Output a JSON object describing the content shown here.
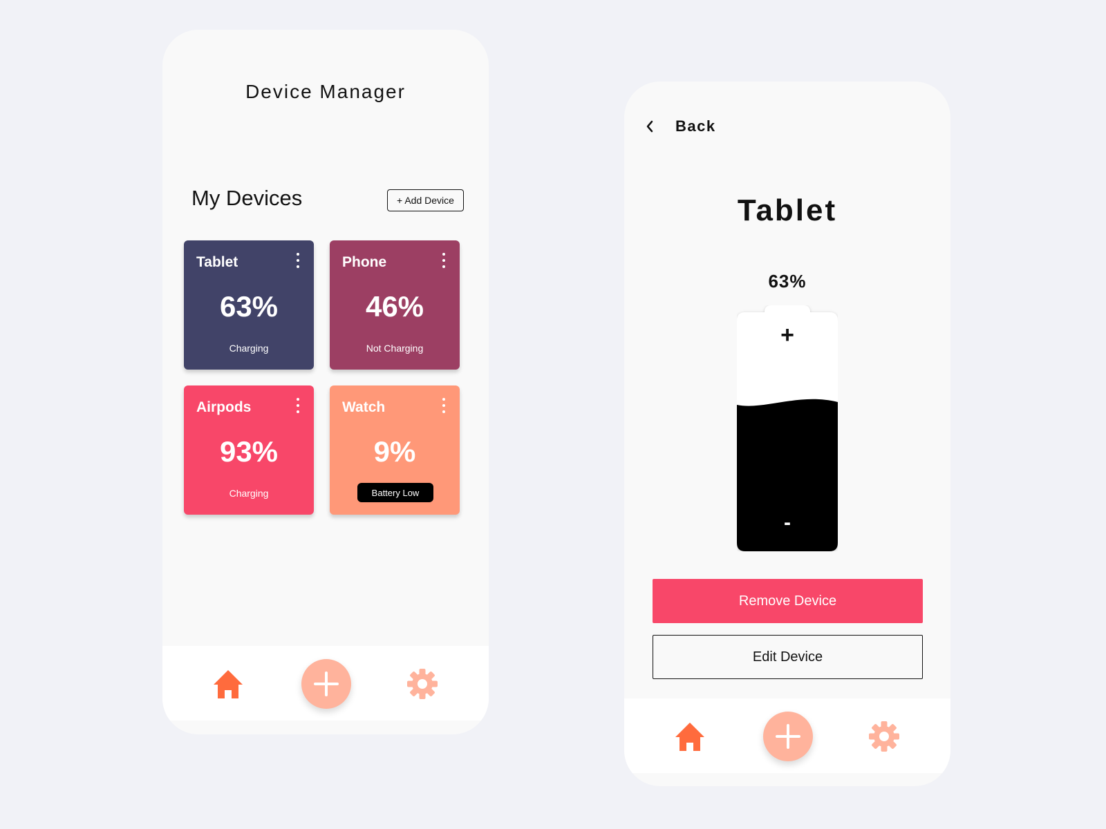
{
  "colors": {
    "tablet_card": "#414368",
    "phone_card": "#9c3f63",
    "airpods_card": "#f84769",
    "watch_card": "#ff9878",
    "accent_orange": "#ff6b3d",
    "accent_peach": "#ffb39c",
    "remove_button": "#f84769"
  },
  "home": {
    "title": "Device Manager",
    "section_title": "My Devices",
    "add_button_label": "+ Add Device",
    "devices": [
      {
        "name": "Tablet",
        "percent": "63%",
        "status": "Charging",
        "color": "#414368"
      },
      {
        "name": "Phone",
        "percent": "46%",
        "status": "Not Charging",
        "color": "#9c3f63"
      },
      {
        "name": "Airpods",
        "percent": "93%",
        "status": "Charging",
        "color": "#f84769"
      },
      {
        "name": "Watch",
        "percent": "9%",
        "status": "Battery Low",
        "color": "#ff9878",
        "status_badge": true
      }
    ]
  },
  "detail": {
    "back_label": "Back",
    "device_name": "Tablet",
    "percent_label": "63%",
    "battery_level": 0.63,
    "plus_symbol": "+",
    "minus_symbol": "-",
    "remove_label": "Remove Device",
    "edit_label": "Edit Device"
  },
  "nav": {
    "items": [
      {
        "icon": "home-icon"
      },
      {
        "icon": "plus-icon"
      },
      {
        "icon": "gear-icon"
      }
    ]
  }
}
